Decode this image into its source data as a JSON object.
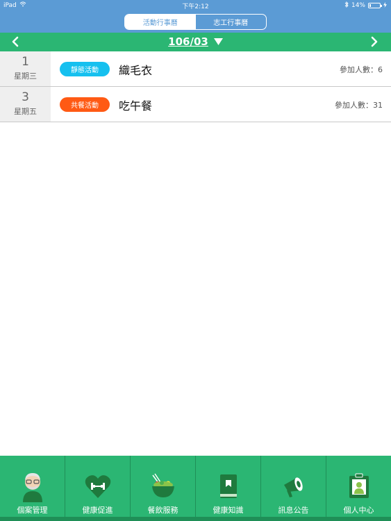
{
  "status": {
    "device": "iPad",
    "time": "下午2:12",
    "battery": "14%",
    "battery_level": 0.14
  },
  "segments": [
    {
      "label": "活動行事曆",
      "active": true
    },
    {
      "label": "志工行事曆",
      "active": false
    }
  ],
  "month": {
    "label": "106/03"
  },
  "rows": [
    {
      "day": "1",
      "weekday": "星期三",
      "badge": "靜態活動",
      "badge_color": "#16c0ef",
      "title": "織毛衣",
      "count_label": "參加人數：6"
    },
    {
      "day": "3",
      "weekday": "星期五",
      "badge": "共餐活動",
      "badge_color": "#ff5a14",
      "title": "吃午餐",
      "count_label": "參加人數：31"
    }
  ],
  "tabs": [
    {
      "label": "個案管理",
      "icon": "elder-icon"
    },
    {
      "label": "健康促進",
      "icon": "heart-dumbbell-icon"
    },
    {
      "label": "餐飲服務",
      "icon": "salad-bowl-icon"
    },
    {
      "label": "健康知識",
      "icon": "book-icon"
    },
    {
      "label": "訊息公告",
      "icon": "megaphone-icon"
    },
    {
      "label": "個人中心",
      "icon": "id-badge-icon"
    }
  ],
  "colors": {
    "header": "#5b9bd5",
    "accent": "#2bb673"
  }
}
